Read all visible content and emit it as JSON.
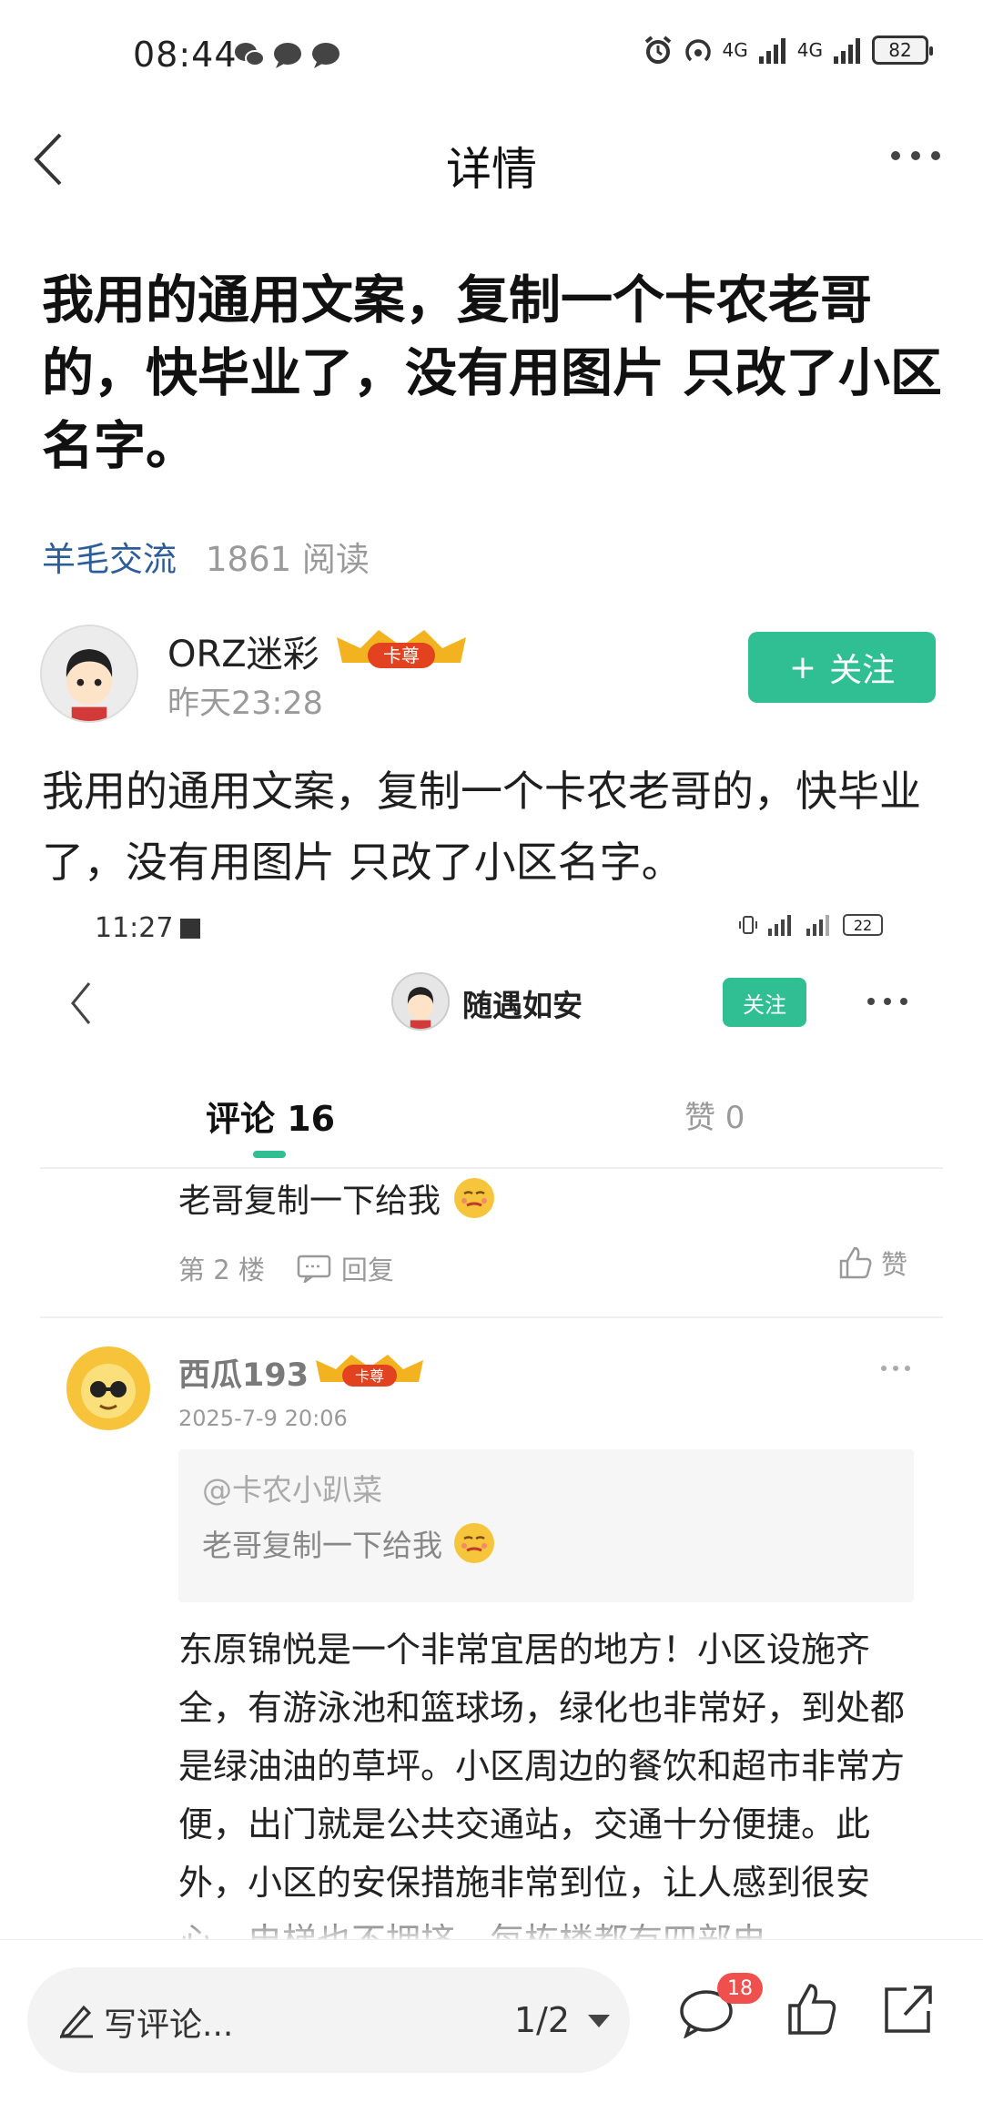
{
  "status_bar": {
    "time": "08:44",
    "battery": "82",
    "signal_1": "4G",
    "signal_2": "4G"
  },
  "nav": {
    "title": "详情"
  },
  "post": {
    "title": "我用的通用文案，复制一个卡农老哥的，快毕业了，没有用图片 只改了小区名字。",
    "category": "羊毛交流",
    "reads": "1861 阅读",
    "author": {
      "name": "ORZ迷彩",
      "badge": "卡尊",
      "time": "昨天23:28"
    },
    "follow_label": "关注",
    "body": "我用的通用文案，复制一个卡农老哥的，快毕业了，没有用图片 只改了小区名字。"
  },
  "embedded": {
    "status_time": "11:27",
    "battery": "22",
    "user_name": "随遇如安",
    "follow_label": "关注",
    "tabs": {
      "comments": "评论 16",
      "likes": "赞 0"
    },
    "comment_1": {
      "text": "老哥复制一下给我",
      "floor": "第 2 楼",
      "reply_label": "回复",
      "like_label": "赞"
    },
    "comment_2": {
      "name": "西瓜193",
      "badge": "卡尊",
      "time": "2025-7-9 20:06",
      "quote_user": "@卡农小趴菜",
      "quote_text": "老哥复制一下给我",
      "body": "东原锦悦是一个非常宜居的地方！小区设施齐全，有游泳池和篮球场，绿化也非常好，到处都是绿油油的草坪。小区周边的餐饮和超市非常方便，出门就是公共交通站，交通十分便捷。此外，小区的安保措施非常到位，让人感到很安心，电梯也不拥挤，每栋楼都有四部电"
    }
  },
  "bottom_bar": {
    "placeholder": "写评论...",
    "page": "1/2",
    "comment_count": "18"
  },
  "colors": {
    "accent": "#2fbf93",
    "link": "#2b5d9a",
    "badge_red": "#f0504d"
  }
}
